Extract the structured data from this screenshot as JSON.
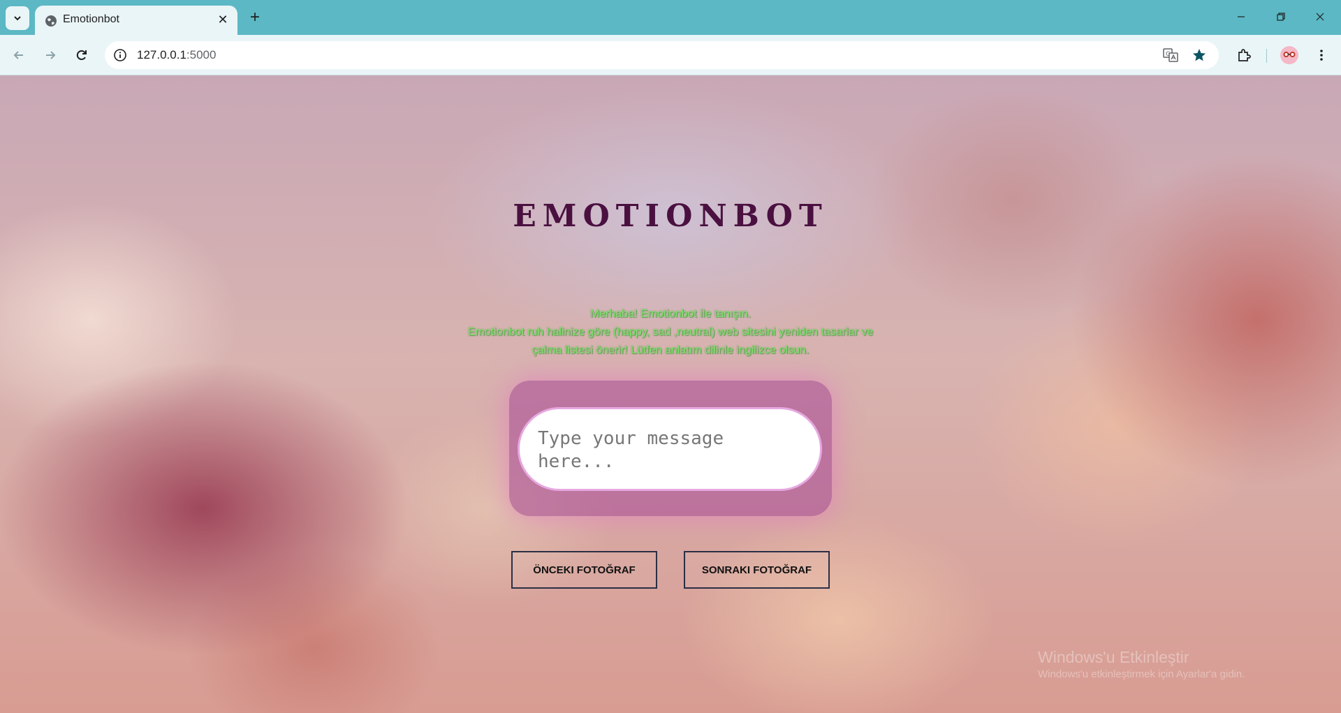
{
  "browser": {
    "tab": {
      "title": "Emotionbot"
    },
    "address_bar": {
      "host": "127.0.0.1",
      "port": ":5000"
    }
  },
  "page": {
    "title": "EMOTIONBOT",
    "intro_lines": [
      "Merhaba! Emotionbot ile tanışın.",
      "Emotionbot ruh halinize göre (happy, sad ,neutral) web sitesini yeniden tasarlar ve",
      "çalma listesi önerir! Lütfen anlatım dilinle ingilizce olsun."
    ],
    "message_input": {
      "placeholder": "Type your message here..."
    },
    "buttons": {
      "prev_photo": "ÖNCEKI FOTOĞRAF",
      "next_photo": "SONRAKI FOTOĞRAF"
    }
  },
  "watermark": {
    "title": "Windows'u Etkinleştir",
    "subtitle": "Windows'u etkinleştirmek için Ayarlar'a gidin."
  },
  "colors": {
    "browser_frame": "#5bb8c4",
    "toolbar": "#eaf5f7",
    "title": "#4a1040",
    "intro_text": "#7ee06a",
    "input_panel": "#a54696",
    "button_border": "#2b2f45"
  }
}
